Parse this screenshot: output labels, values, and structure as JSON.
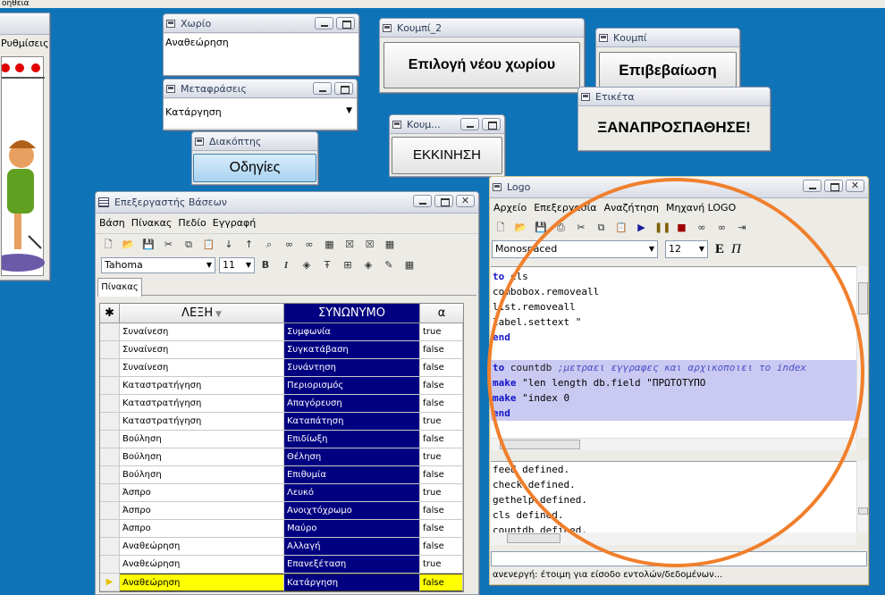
{
  "top_menu": {
    "fragment": "οηθεια"
  },
  "left_window": {
    "menu_fragment": "Ρυθμίσεις"
  },
  "room_window": {
    "title": "Χωρίο",
    "value": "Αναθεώρηση"
  },
  "translations_window": {
    "title": "Μεταφράσεις",
    "selected": "Κατάργηση"
  },
  "switch_window": {
    "title": "Διακόπτης",
    "button_label": "Οδηγίες"
  },
  "button2_window": {
    "title": "Κουμπί_2",
    "button_label": "Επιλογή νέου χωρίου"
  },
  "button_window": {
    "title": "Κουμπί",
    "button_label": "Επιβεβαίωση"
  },
  "label_window": {
    "title": "Ετικέτα",
    "text": "ΞΑΝΑΠΡΟΣΠΑΘΗΣΕ!"
  },
  "start_window": {
    "title": "Κουμ...",
    "button_label": "ΕΚΚΙΝΗΣΗ"
  },
  "db_editor": {
    "title": "Επεξεργαστής Βάσεων",
    "menu": [
      "Βάση",
      "Πίνακας",
      "Πεδίο",
      "Εγγραφή"
    ],
    "font_name": "Tahoma",
    "font_size": "11",
    "tab": "Πίνακας",
    "corner": "✱",
    "columns": [
      "ΛΕΞΗ",
      "ΣΥΝΩΝΥΜΟ",
      "α"
    ],
    "rows": [
      [
        "Συναίνεση",
        "Συμφωνία",
        "true"
      ],
      [
        "Συναίνεση",
        "Συγκατάβαση",
        "false"
      ],
      [
        "Συναίνεση",
        "Συνάντηση",
        "false"
      ],
      [
        "Καταστρατήγηση",
        "Περιορισμός",
        "false"
      ],
      [
        "Καταστρατήγηση",
        "Απαγόρευση",
        "false"
      ],
      [
        "Καταστρατήγηση",
        "Καταπάτηση",
        "true"
      ],
      [
        "Βούληση",
        "Επιδίωξη",
        "false"
      ],
      [
        "Βούληση",
        "Θέληση",
        "true"
      ],
      [
        "Βούληση",
        "Επιθυμία",
        "false"
      ],
      [
        "Άσπρο",
        "Λευκό",
        "true"
      ],
      [
        "Άσπρο",
        "Ανοιχτόχρωμο",
        "false"
      ],
      [
        "Άσπρο",
        "Μαύρο",
        "false"
      ],
      [
        "Αναθεώρηση",
        "Αλλαγή",
        "false"
      ],
      [
        "Αναθεώρηση",
        "Επανεξέταση",
        "true"
      ],
      [
        "Αναθεώρηση",
        "Κατάργηση",
        "false"
      ]
    ],
    "selected_row": 14
  },
  "logo_window": {
    "title": "Logo",
    "menu": [
      "Αρχείο",
      "Επεξεργασία",
      "Αναζήτηση",
      "Μηχανή LOGO"
    ],
    "font_name": "Monospaced",
    "font_size": "12",
    "bold_label": "E",
    "italic_label": "Π",
    "code_lines": [
      {
        "t": "to cls",
        "hl": false
      },
      {
        "t": "combobox.removeall",
        "hl": false
      },
      {
        "t": "list.removeall",
        "hl": false
      },
      {
        "t": "label.settext \"",
        "hl": false
      },
      {
        "t": "end",
        "hl": false
      },
      {
        "t": "",
        "hl": false
      },
      {
        "t": "to countdb ;μετραει εγγραφες και αρχικοποιει το index",
        "hl": true
      },
      {
        "t": "make \"len length db.field \"ΠΡΩΤΟΤΥΠΟ",
        "hl": true
      },
      {
        "t": "make \"index 0",
        "hl": true
      },
      {
        "t": "end",
        "hl": true
      }
    ],
    "output_lines": [
      "feed defined.",
      "check defined.",
      "gethelp defined.",
      "cls defined.",
      "countdb defined."
    ],
    "status": "ανενεργή: έτοιμη για είσοδο εντολών/δεδομένων..."
  },
  "colors": {
    "desktop": "#0f73b7",
    "selection": "#000080",
    "highlight": "#ffff00",
    "annotation": "#f07f2c"
  }
}
